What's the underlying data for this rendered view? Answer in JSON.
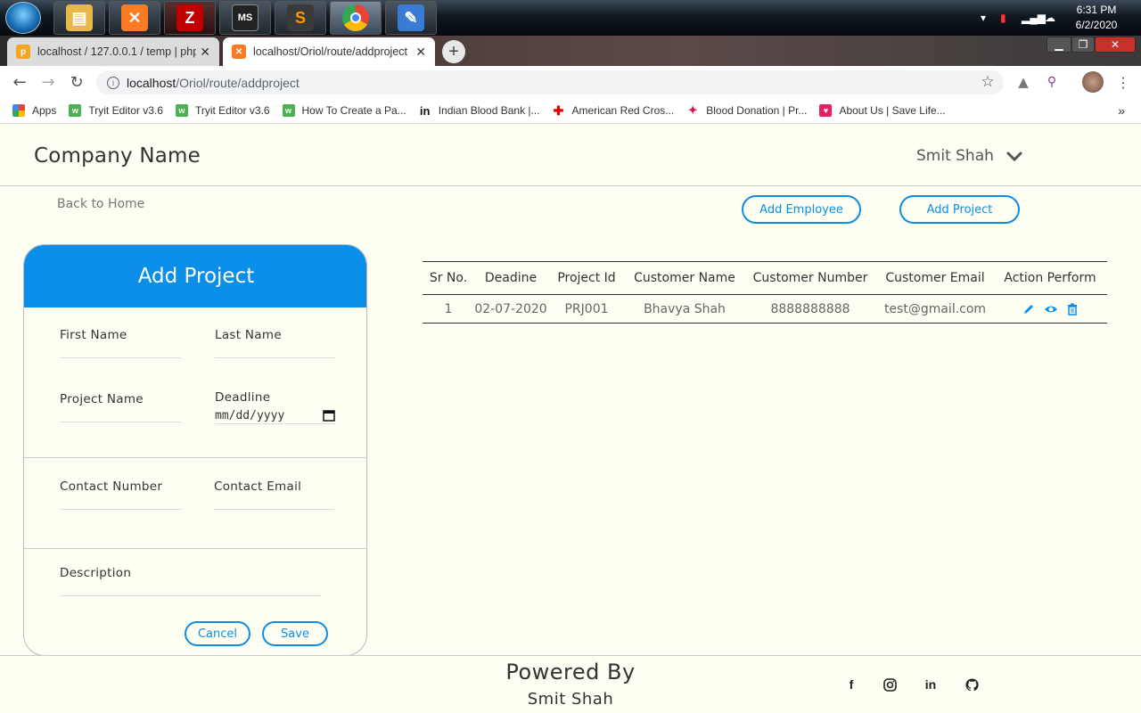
{
  "taskbar": {
    "clock_time": "6:31 PM",
    "clock_date": "6/2/2020",
    "apps": [
      {
        "icon": "file-explorer-icon",
        "color": "#e8b84a"
      },
      {
        "icon": "xampp-icon",
        "color": "#fb7a24"
      },
      {
        "icon": "filezilla-icon",
        "color": "#bf0000"
      },
      {
        "icon": "ms-office-icon",
        "color": "#222222"
      },
      {
        "icon": "sublime-text-icon",
        "color": "#3a3a3a"
      },
      {
        "icon": "chrome-icon",
        "color": "#4285f4"
      },
      {
        "icon": "paint-icon",
        "color": "#3a7bd5"
      }
    ]
  },
  "browser": {
    "tabs": [
      {
        "title": "localhost / 127.0.0.1 / temp | php",
        "active": false
      },
      {
        "title": "localhost/Oriol/route/addproject",
        "active": true
      }
    ],
    "address": {
      "host": "localhost",
      "path": "/Oriol/route/addproject"
    },
    "bookmarks": [
      {
        "label": "Apps",
        "icon": "apps-grid-icon",
        "color": "#4285f4"
      },
      {
        "label": "Tryit Editor v3.6",
        "icon": "w3schools-icon",
        "color": "#4caf50"
      },
      {
        "label": "Tryit Editor v3.6",
        "icon": "w3schools-icon",
        "color": "#4caf50"
      },
      {
        "label": "How To Create a Pa...",
        "icon": "w3schools-icon",
        "color": "#4caf50"
      },
      {
        "label": "Indian Blood Bank |...",
        "icon": "linkedin-icon",
        "color": "#111111"
      },
      {
        "label": "American Red Cros...",
        "icon": "red-cross-icon",
        "color": "#e00000"
      },
      {
        "label": "Blood Donation | Pr...",
        "icon": "blood-drop-icon",
        "color": "#d4145a"
      },
      {
        "label": "About Us | Save Life...",
        "icon": "save-life-icon",
        "color": "#e91e63"
      }
    ]
  },
  "page": {
    "company": "Company Name",
    "user": "Smit Shah",
    "back_link": "Back to Home",
    "add_employee": "Add Employee",
    "add_project": "Add Project",
    "accent": "#0a8ee8"
  },
  "form": {
    "title": "Add Project",
    "first_name": "First Name",
    "last_name": "Last Name",
    "project_name": "Project Name",
    "deadline": "Deadline",
    "deadline_placeholder": "mm/dd/yyyy",
    "contact_number": "Contact Number",
    "contact_email": "Contact Email",
    "description": "Description",
    "cancel": "Cancel",
    "save": "Save"
  },
  "table": {
    "headers": [
      "Sr No.",
      "Deadine",
      "Project Id",
      "Customer Name",
      "Customer Number",
      "Customer Email",
      "Action Perform"
    ],
    "rows": [
      {
        "sr": "1",
        "deadline": "02-07-2020",
        "project_id": "PRJ001",
        "customer_name": "Bhavya Shah",
        "customer_number": "8888888888",
        "customer_email": "test@gmail.com",
        "actions": [
          "edit-icon",
          "view-icon",
          "delete-icon"
        ]
      }
    ]
  },
  "footer": {
    "powered": "Powered By",
    "author": "Smit Shah",
    "social": [
      "facebook-icon",
      "instagram-icon",
      "linkedin-icon",
      "github-icon"
    ]
  }
}
